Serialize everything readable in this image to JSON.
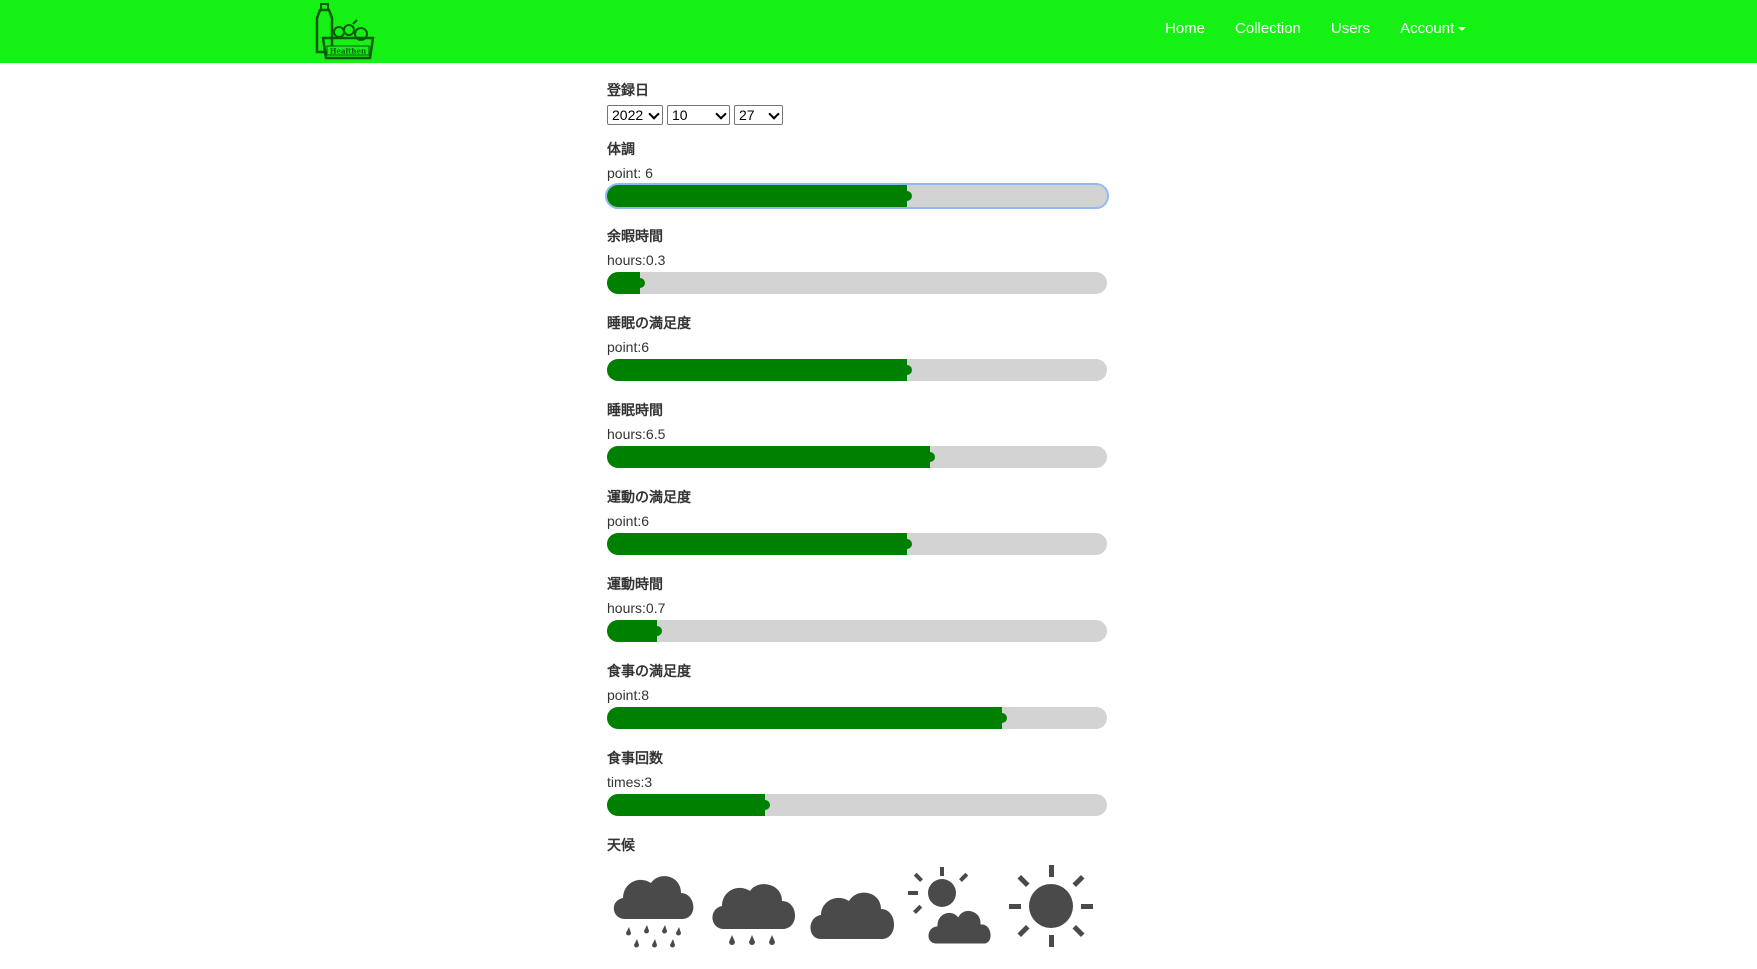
{
  "nav": {
    "logo_text": "Healthen",
    "links": [
      "Home",
      "Collection",
      "Users"
    ],
    "account_label": "Account"
  },
  "form": {
    "date": {
      "label": "登録日",
      "year": "2022",
      "month": "10",
      "day": "27"
    },
    "sliders": [
      {
        "label": "体調",
        "value_text": "point: 6",
        "fraction": 0.6,
        "focused": true
      },
      {
        "label": "余暇時間",
        "value_text": "hours:0.3",
        "fraction": 0.065,
        "focused": false
      },
      {
        "label": "睡眠の満足度",
        "value_text": "point:6",
        "fraction": 0.6,
        "focused": false
      },
      {
        "label": "睡眠時間",
        "value_text": "hours:6.5",
        "fraction": 0.645,
        "focused": false
      },
      {
        "label": "運動の満足度",
        "value_text": "point:6",
        "fraction": 0.6,
        "focused": false
      },
      {
        "label": "運動時間",
        "value_text": "hours:0.7",
        "fraction": 0.1,
        "focused": false
      },
      {
        "label": "食事の満足度",
        "value_text": "point:8",
        "fraction": 0.79,
        "focused": false
      },
      {
        "label": "食事回数",
        "value_text": "times:3",
        "fraction": 0.315,
        "focused": false
      }
    ],
    "weather": {
      "label": "天候",
      "icons": [
        "rain-heavy-icon",
        "rain-light-icon",
        "cloud-icon",
        "partly-sunny-icon",
        "sun-icon"
      ],
      "icon_color": "#4a4a4a"
    }
  },
  "colors": {
    "navbar": "#15f115",
    "slider_fill": "#008000",
    "slider_track": "#d3d3d3"
  }
}
